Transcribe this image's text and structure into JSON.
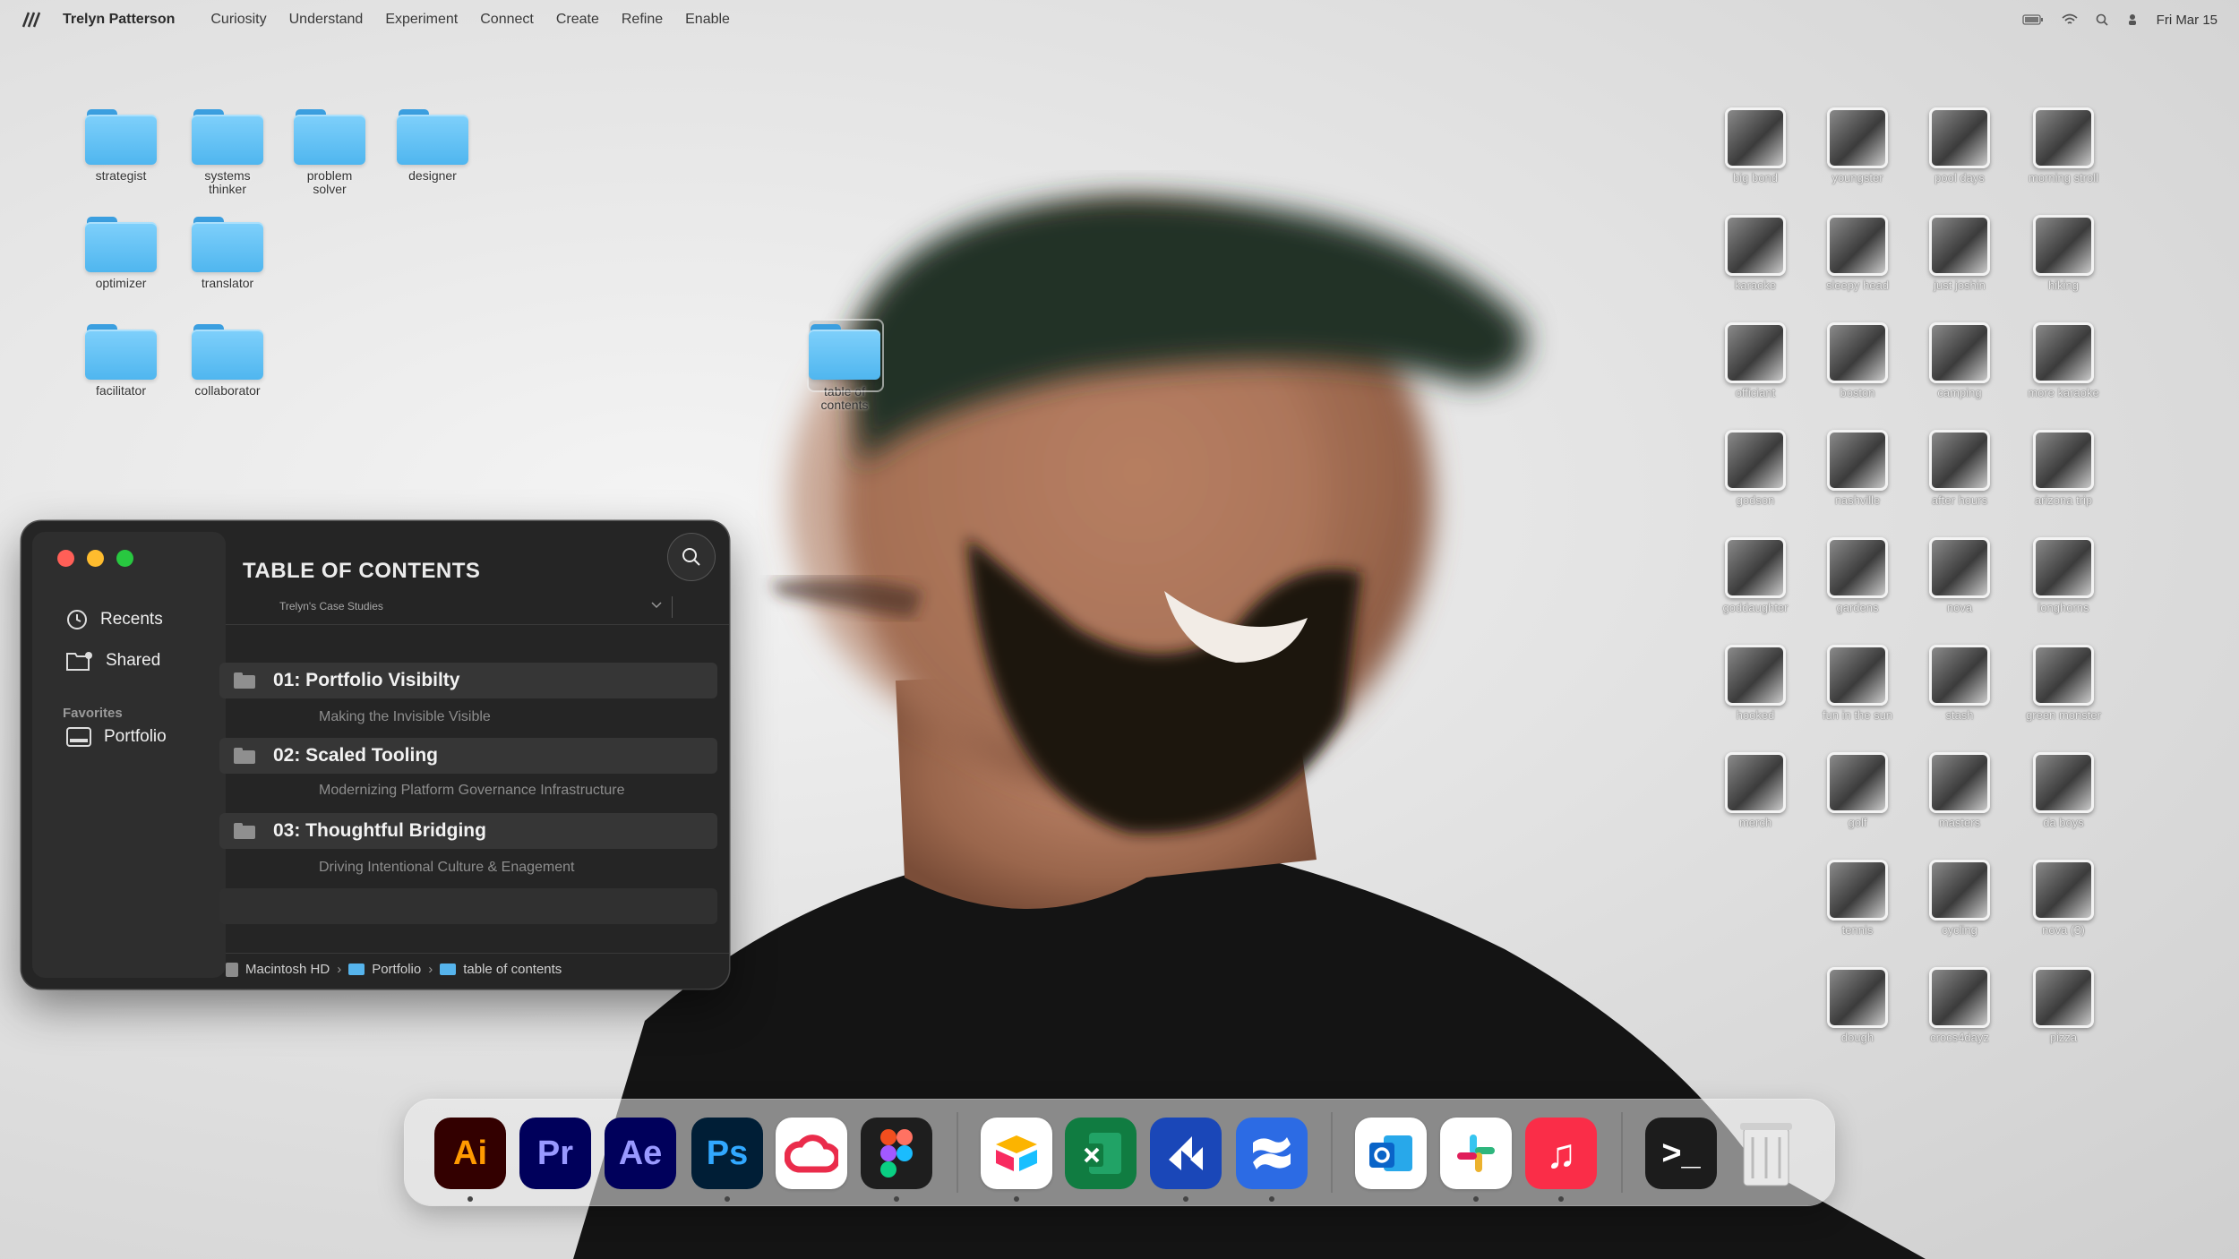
{
  "menubar": {
    "owner": "Trelyn Patterson",
    "items": [
      "Curiosity",
      "Understand",
      "Experiment",
      "Connect",
      "Create",
      "Refine",
      "Enable"
    ],
    "date": "Fri Mar 15"
  },
  "desktop_folders": [
    {
      "label": "strategist"
    },
    {
      "label": "systems thinker"
    },
    {
      "label": "problem solver"
    },
    {
      "label": "designer"
    },
    {
      "label": "optimizer"
    },
    {
      "label": "translator"
    },
    {
      "label": "facilitator"
    },
    {
      "label": "collaborator"
    },
    {
      "label": "table of contents"
    }
  ],
  "photos": [
    "big bond",
    "youngster",
    "pool days",
    "morning stroll",
    "karaoke",
    "sleepy head",
    "just joshin",
    "hiking",
    "officiant",
    "boston",
    "camping",
    "more karaoke",
    "godson",
    "nashville",
    "after hours",
    "arizona trip",
    "goddaughter",
    "gardens",
    "nova",
    "longhorns",
    "hooked",
    "fun in the sun",
    "stash",
    "green monster",
    "merch",
    "golf",
    "masters",
    "da boys",
    "tennis",
    "cycling",
    "nova (3)",
    "dough",
    "crocs4dayz",
    "pizza"
  ],
  "finder": {
    "sidebar": {
      "recents": "Recents",
      "shared": "Shared",
      "favorites_header": "Favorites",
      "portfolio": "Portfolio"
    },
    "title": "TABLE OF CONTENTS",
    "subtitle": "Trelyn's Case Studies",
    "items": [
      {
        "label": "01:  Portfolio Visibilty",
        "desc": "Making the Invisible Visible"
      },
      {
        "label": "02:  Scaled Tooling",
        "desc": "Modernizing Platform Governance Infrastructure"
      },
      {
        "label": "03:  Thoughtful Bridging",
        "desc": "Driving Intentional Culture & Enagement"
      }
    ],
    "path": [
      "Macintosh HD",
      "Portfolio",
      "table of contents"
    ]
  },
  "dock": {
    "apps": [
      {
        "icon": "illustrator-icon",
        "text": "Ai",
        "bg": "#330000",
        "fg": "#ff9a00"
      },
      {
        "icon": "premiere-icon",
        "text": "Pr",
        "bg": "#00005b",
        "fg": "#9999ff"
      },
      {
        "icon": "after-effects-icon",
        "text": "Ae",
        "bg": "#00005b",
        "fg": "#9999ff"
      },
      {
        "icon": "photoshop-icon",
        "text": "Ps",
        "bg": "#001e36",
        "fg": "#31a8ff"
      },
      {
        "icon": "creative-cloud-icon",
        "text": "",
        "bg": "#ffffff",
        "fg": "#ea2c4b"
      },
      {
        "icon": "figma-icon",
        "text": "",
        "bg": "#1e1e1e",
        "fg": "#ffffff"
      },
      {
        "icon": "airtable-icon",
        "text": "",
        "bg": "#ffffff",
        "fg": "#fcb400"
      },
      {
        "icon": "excel-icon",
        "text": "",
        "bg": "#107c41",
        "fg": "#ffffff"
      },
      {
        "icon": "jira-align-icon",
        "text": "",
        "bg": "#1a47b8",
        "fg": "#ffffff"
      },
      {
        "icon": "confluence-icon",
        "text": "",
        "bg": "#2c6be4",
        "fg": "#ffffff"
      },
      {
        "icon": "outlook-icon",
        "text": "",
        "bg": "#ffffff",
        "fg": "#0a64c8"
      },
      {
        "icon": "slack-icon",
        "text": "",
        "bg": "#ffffff",
        "fg": "#e01e5a"
      },
      {
        "icon": "music-icon",
        "text": "♫",
        "bg": "#fa2d48",
        "fg": "#ffffff"
      },
      {
        "icon": "terminal-icon",
        "text": ">_",
        "bg": "#1c1c1c",
        "fg": "#ffffff"
      },
      {
        "icon": "trash-icon",
        "text": "",
        "bg": "transparent",
        "fg": "#888888"
      }
    ]
  }
}
